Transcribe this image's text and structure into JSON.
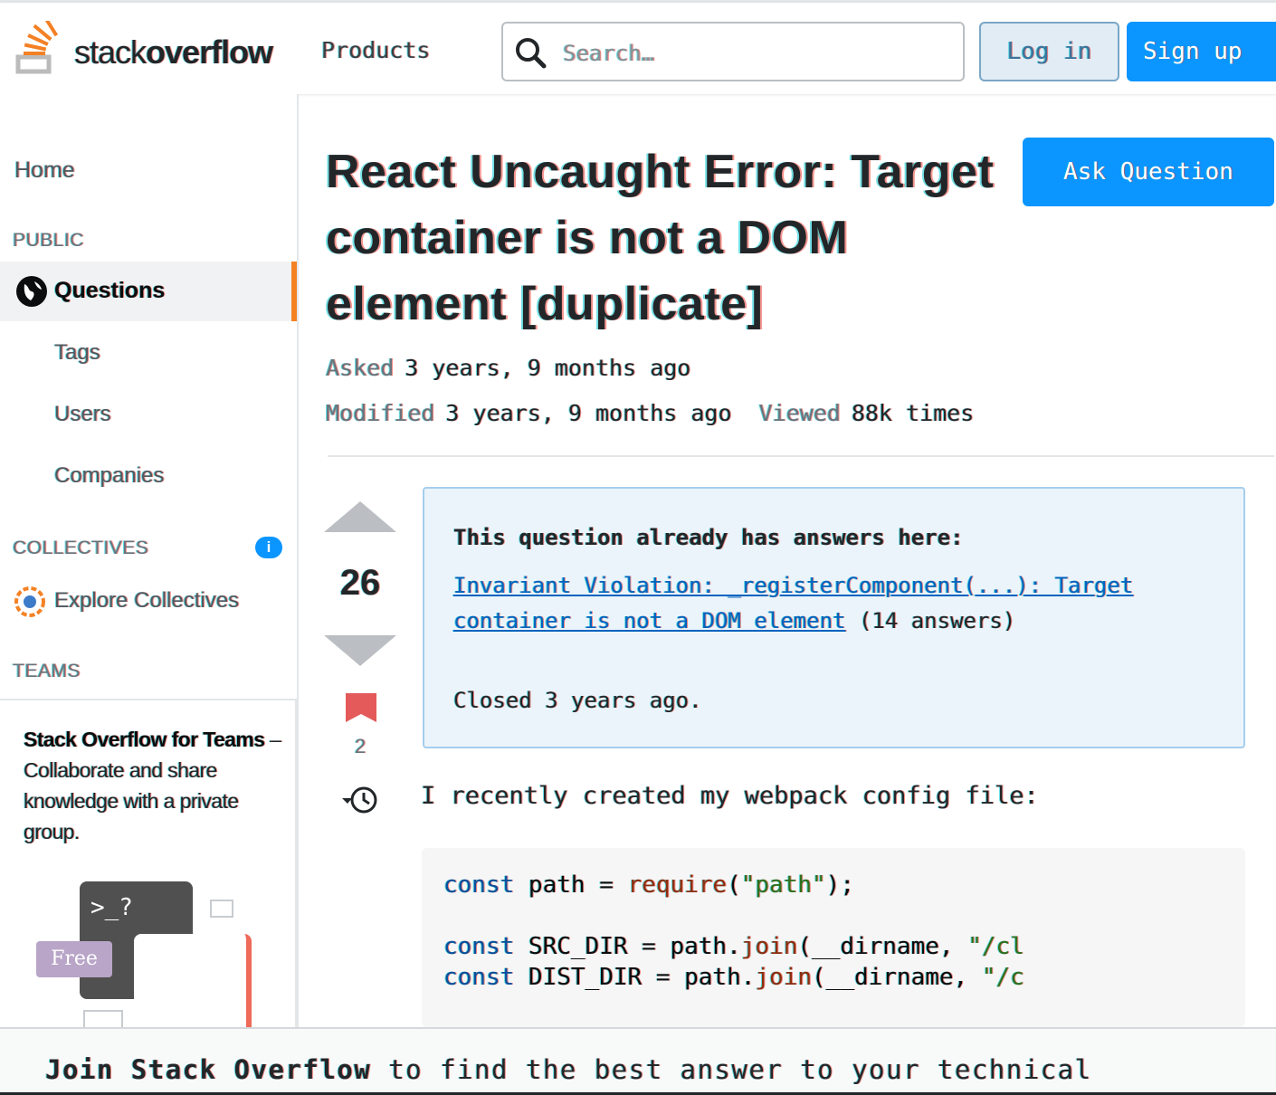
{
  "header": {
    "logo_light": "stack",
    "logo_bold": "overflow",
    "products_label": "Products",
    "search_placeholder": "Search…",
    "login_label": "Log in",
    "signup_label": "Sign up"
  },
  "sidebar": {
    "home_label": "Home",
    "public_label": "PUBLIC",
    "questions_label": "Questions",
    "tags_label": "Tags",
    "users_label": "Users",
    "companies_label": "Companies",
    "collectives_label": "COLLECTIVES",
    "info_badge": "i",
    "explore_label": "Explore Collectives",
    "teams_label": "TEAMS",
    "teams_promo": {
      "title": "Stack Overflow for Teams",
      "dash": " – ",
      "text": "Collaborate and share knowledge with a private group.",
      "prompt": ">_?",
      "free_badge": "Free"
    }
  },
  "question": {
    "title": "React Uncaught Error: Target container is not a DOM element [duplicate]",
    "ask_button": "Ask Question",
    "asked_key": "Asked",
    "asked_value": "3 years, 9 months ago",
    "modified_key": "Modified",
    "modified_value": "3 years, 9 months ago",
    "viewed_key": "Viewed",
    "viewed_value": "88k times",
    "votes": "26",
    "bookmarks": "2",
    "duplicate": {
      "heading": "This question already has answers here:",
      "link_text": "Invariant Violation: _registerComponent(...): Target container is not a DOM element",
      "answers": "(14 answers)",
      "closed": "Closed 3 years ago."
    },
    "body_text": "I recently created my webpack config file:",
    "code": {
      "line1": {
        "kw": "const",
        "rest": " path = ",
        "fn": "require",
        "tail": "(",
        "str": "\"path\"",
        "end": ");"
      },
      "line2": {
        "kw": "const",
        "rest": " SRC_DIR = path.",
        "fn": "join",
        "tail": "(__dirname, ",
        "str": "\"/cl"
      },
      "line3": {
        "kw": "const",
        "rest": " DIST_DIR = path.",
        "fn": "join",
        "tail": "(__dirname, ",
        "str": "\"/c"
      }
    }
  },
  "banner": {
    "bold": "Join Stack Overflow",
    "rest": " to find the best answer to your technical"
  },
  "colors": {
    "accent": "#0a95ff",
    "active_nav_border": "#f48225",
    "duplicate_box": "#ebf4fb",
    "link": "#0063bf"
  }
}
